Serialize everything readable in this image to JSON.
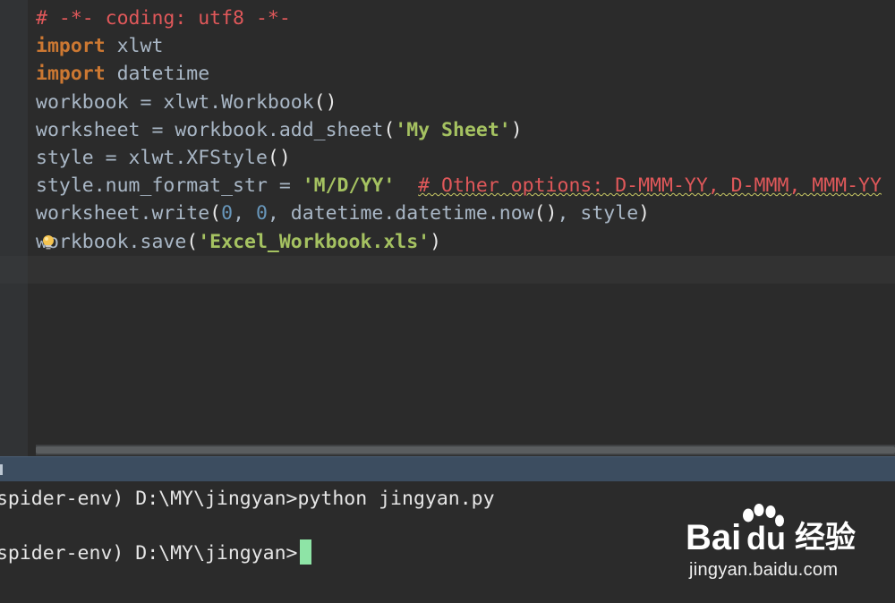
{
  "editor": {
    "lines": [
      [
        {
          "t": "# -*- coding: utf8 -*-",
          "c": "cmt"
        }
      ],
      [
        {
          "t": "import",
          "c": "kw"
        },
        {
          "t": " xlwt",
          "c": ""
        }
      ],
      [
        {
          "t": "import",
          "c": "kw"
        },
        {
          "t": " datetime",
          "c": ""
        }
      ],
      [
        {
          "t": "workbook = xlwt.Workbook",
          "c": ""
        },
        {
          "t": "()",
          "c": "punct"
        }
      ],
      [
        {
          "t": "worksheet = workbook.add_sheet",
          "c": ""
        },
        {
          "t": "(",
          "c": "punct"
        },
        {
          "t": "'My Sheet'",
          "c": "strg"
        },
        {
          "t": ")",
          "c": "punct"
        }
      ],
      [
        {
          "t": "style = xlwt.XFStyle",
          "c": ""
        },
        {
          "t": "()",
          "c": "punct"
        }
      ],
      [
        {
          "t": "style.num_format_str = ",
          "c": ""
        },
        {
          "t": "'M/D/YY'",
          "c": "strg"
        },
        {
          "t": "  ",
          "c": ""
        },
        {
          "t": "# Other options: D-MMM-YY, D-MMM, MMM-YY",
          "c": "cmt-warn"
        }
      ],
      [
        {
          "t": "worksheet.write",
          "c": ""
        },
        {
          "t": "(",
          "c": "punct"
        },
        {
          "t": "0",
          "c": "num"
        },
        {
          "t": ", ",
          "c": ""
        },
        {
          "t": "0",
          "c": "num"
        },
        {
          "t": ", datetime.datetime.now",
          "c": ""
        },
        {
          "t": "()",
          "c": "punct"
        },
        {
          "t": ", style",
          "c": ""
        },
        {
          "t": ")",
          "c": "punct"
        }
      ],
      [
        {
          "t": "workbook.save",
          "c": ""
        },
        {
          "t": "(",
          "c": "punct"
        },
        {
          "t": "'Excel_Workbook.xls'",
          "c": "strg"
        },
        {
          "t": ")",
          "c": "punct"
        }
      ],
      [
        {
          "t": " ",
          "c": ""
        }
      ]
    ],
    "intention_icon": "lightbulb-icon"
  },
  "terminal": {
    "line1_prefix": "(spider-env) D:\\MY\\jingyan>",
    "line1_command": "python jingyan.py",
    "line2_prefix": "(spider-env) D:\\MY\\jingyan>"
  },
  "watermark": {
    "brand_text": "Bai",
    "brand_suffix": "du",
    "product_text": "经验",
    "url": "jingyan.baidu.com"
  },
  "colors": {
    "editor_bg": "#2b2b2b",
    "keyword": "#cc7832",
    "string": "#a5c261",
    "number": "#6897bb",
    "comment": "#e0585a",
    "cursor": "#8ee4a6",
    "terminal_header": "#3c4d60"
  }
}
